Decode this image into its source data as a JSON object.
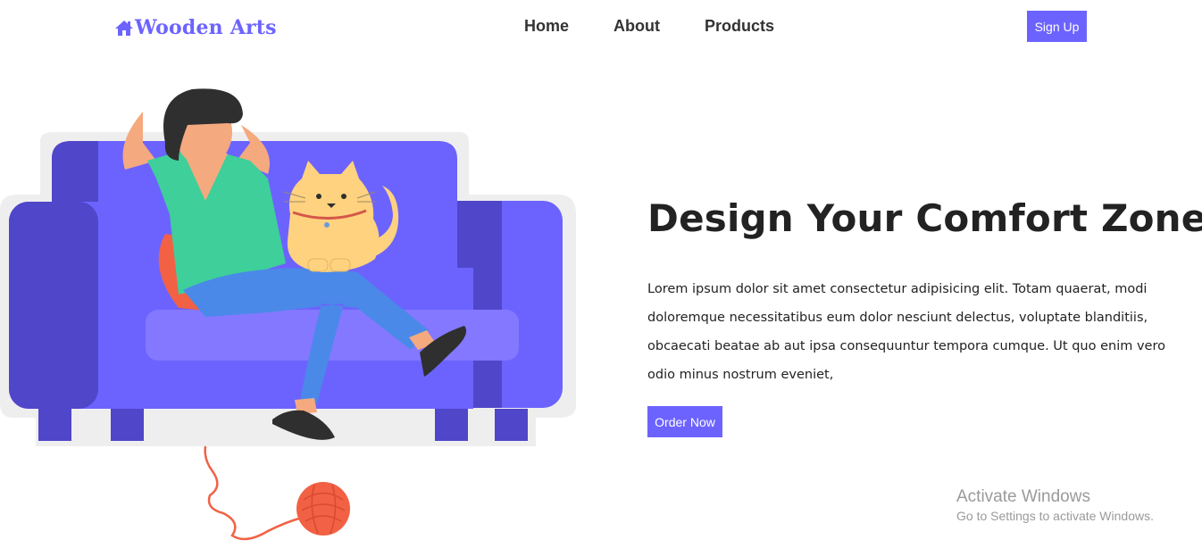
{
  "brand": {
    "name": "Wooden Arts",
    "icon": "home-icon",
    "color": "#6c63ff"
  },
  "nav": {
    "items": [
      {
        "label": "Home"
      },
      {
        "label": "About"
      },
      {
        "label": "Products"
      }
    ]
  },
  "header": {
    "signup_label": "Sign Up"
  },
  "hero": {
    "title": "Design Your Comfort Zone.",
    "description": "Lorem ipsum dolor sit amet consectetur adipisicing elit. Totam quaerat, modi doloremque necessitatibus eum dolor nesciunt delectus, voluptate blanditiis, obcaecati beatae ab aut ipsa consequuntur tempora cumque. Ut quo enim vero odio minus nostrum eveniet,",
    "cta_label": "Order Now"
  },
  "watermark": {
    "title": "Activate Windows",
    "subtitle": "Go to Settings to activate Windows."
  },
  "colors": {
    "accent": "#6c63ff",
    "sofa_dark": "#4f46c9",
    "sofa_light": "#6c63ff",
    "shirt": "#3ecf9a",
    "jeans": "#4a89e8",
    "cat": "#ffd27f",
    "yarn": "#f26144"
  }
}
